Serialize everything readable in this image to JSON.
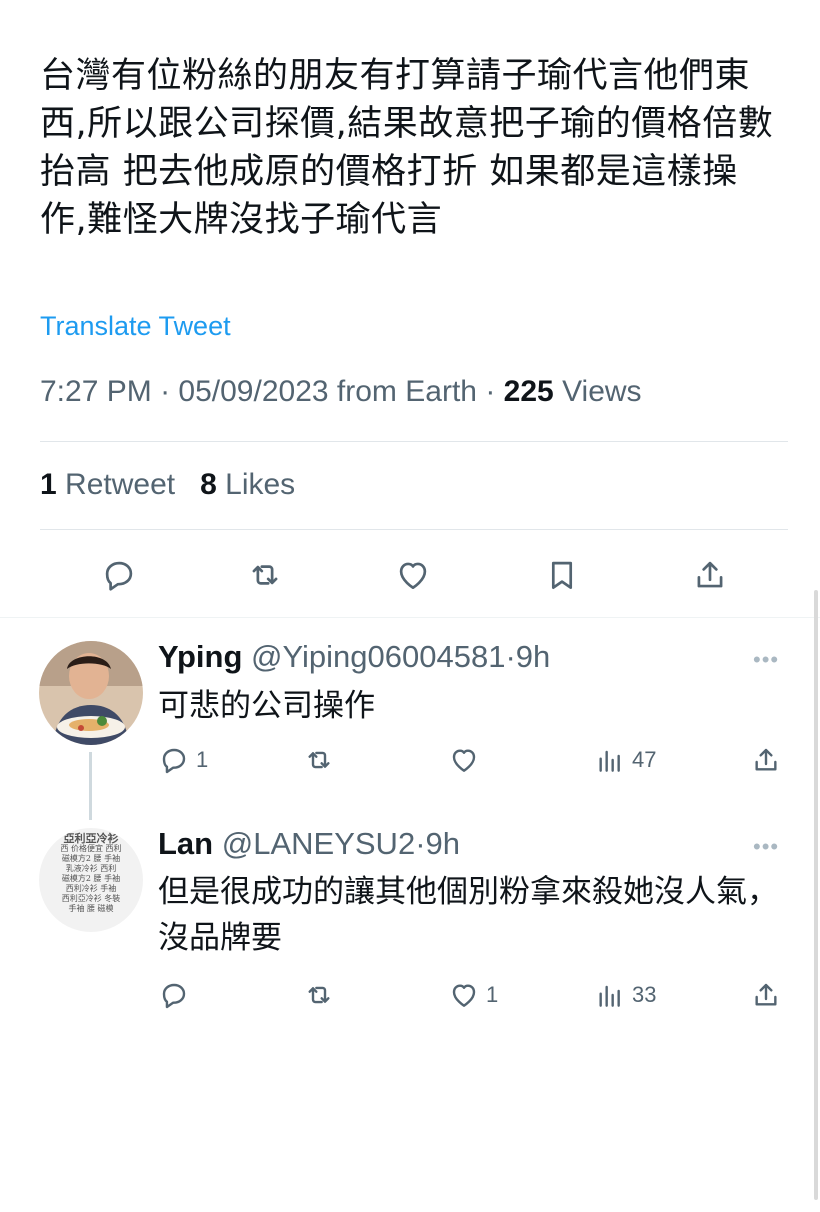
{
  "tweet": {
    "text": "台灣有位粉絲的朋友有打算請子瑜代言他們東西,所以跟公司探價,結果故意把子瑜的價格倍數抬高 把去他成原的價格打折 如果都是這樣操作,難怪大牌沒找子瑜代言",
    "translate_label": "Translate Tweet",
    "time": "7:27 PM",
    "date": "05/09/2023",
    "source": "from Earth",
    "views_count": "225",
    "views_label": "Views",
    "retweets_count": "1",
    "retweets_label": "Retweet",
    "likes_count": "8",
    "likes_label": "Likes",
    "actions": [
      "reply-icon",
      "retweet-icon",
      "like-icon",
      "bookmark-icon",
      "share-icon"
    ]
  },
  "replies": [
    {
      "name": "Yping",
      "handle": "@Yiping06004581",
      "age": "9h",
      "text": "可悲的公司操作",
      "reply_count": "1",
      "retweet_count": "",
      "like_count": "",
      "views_count": "47"
    },
    {
      "name": "Lan",
      "handle": "@LANEYSU2",
      "age": "9h",
      "text": "但是很成功的讓其他個別粉拿來殺她沒人氣，沒品牌要",
      "reply_count": "",
      "retweet_count": "",
      "like_count": "1",
      "views_count": "33"
    }
  ],
  "ui": {
    "separator": "·",
    "more_label": "•••",
    "avatar_text_lines": [
      "亞利亞冷衫",
      "西 价格便宜 西利",
      "磁模方2 腰 手袖",
      "乳液冷衫 西利",
      "磁模方2 腰 手袖",
      "西利冷衫 手袖",
      "西利亞冷衫 冬裝",
      "手袖 腰 磁模"
    ]
  },
  "colors": {
    "accent": "#1d9bf0",
    "text": "#0f1419",
    "muted": "#536471"
  }
}
